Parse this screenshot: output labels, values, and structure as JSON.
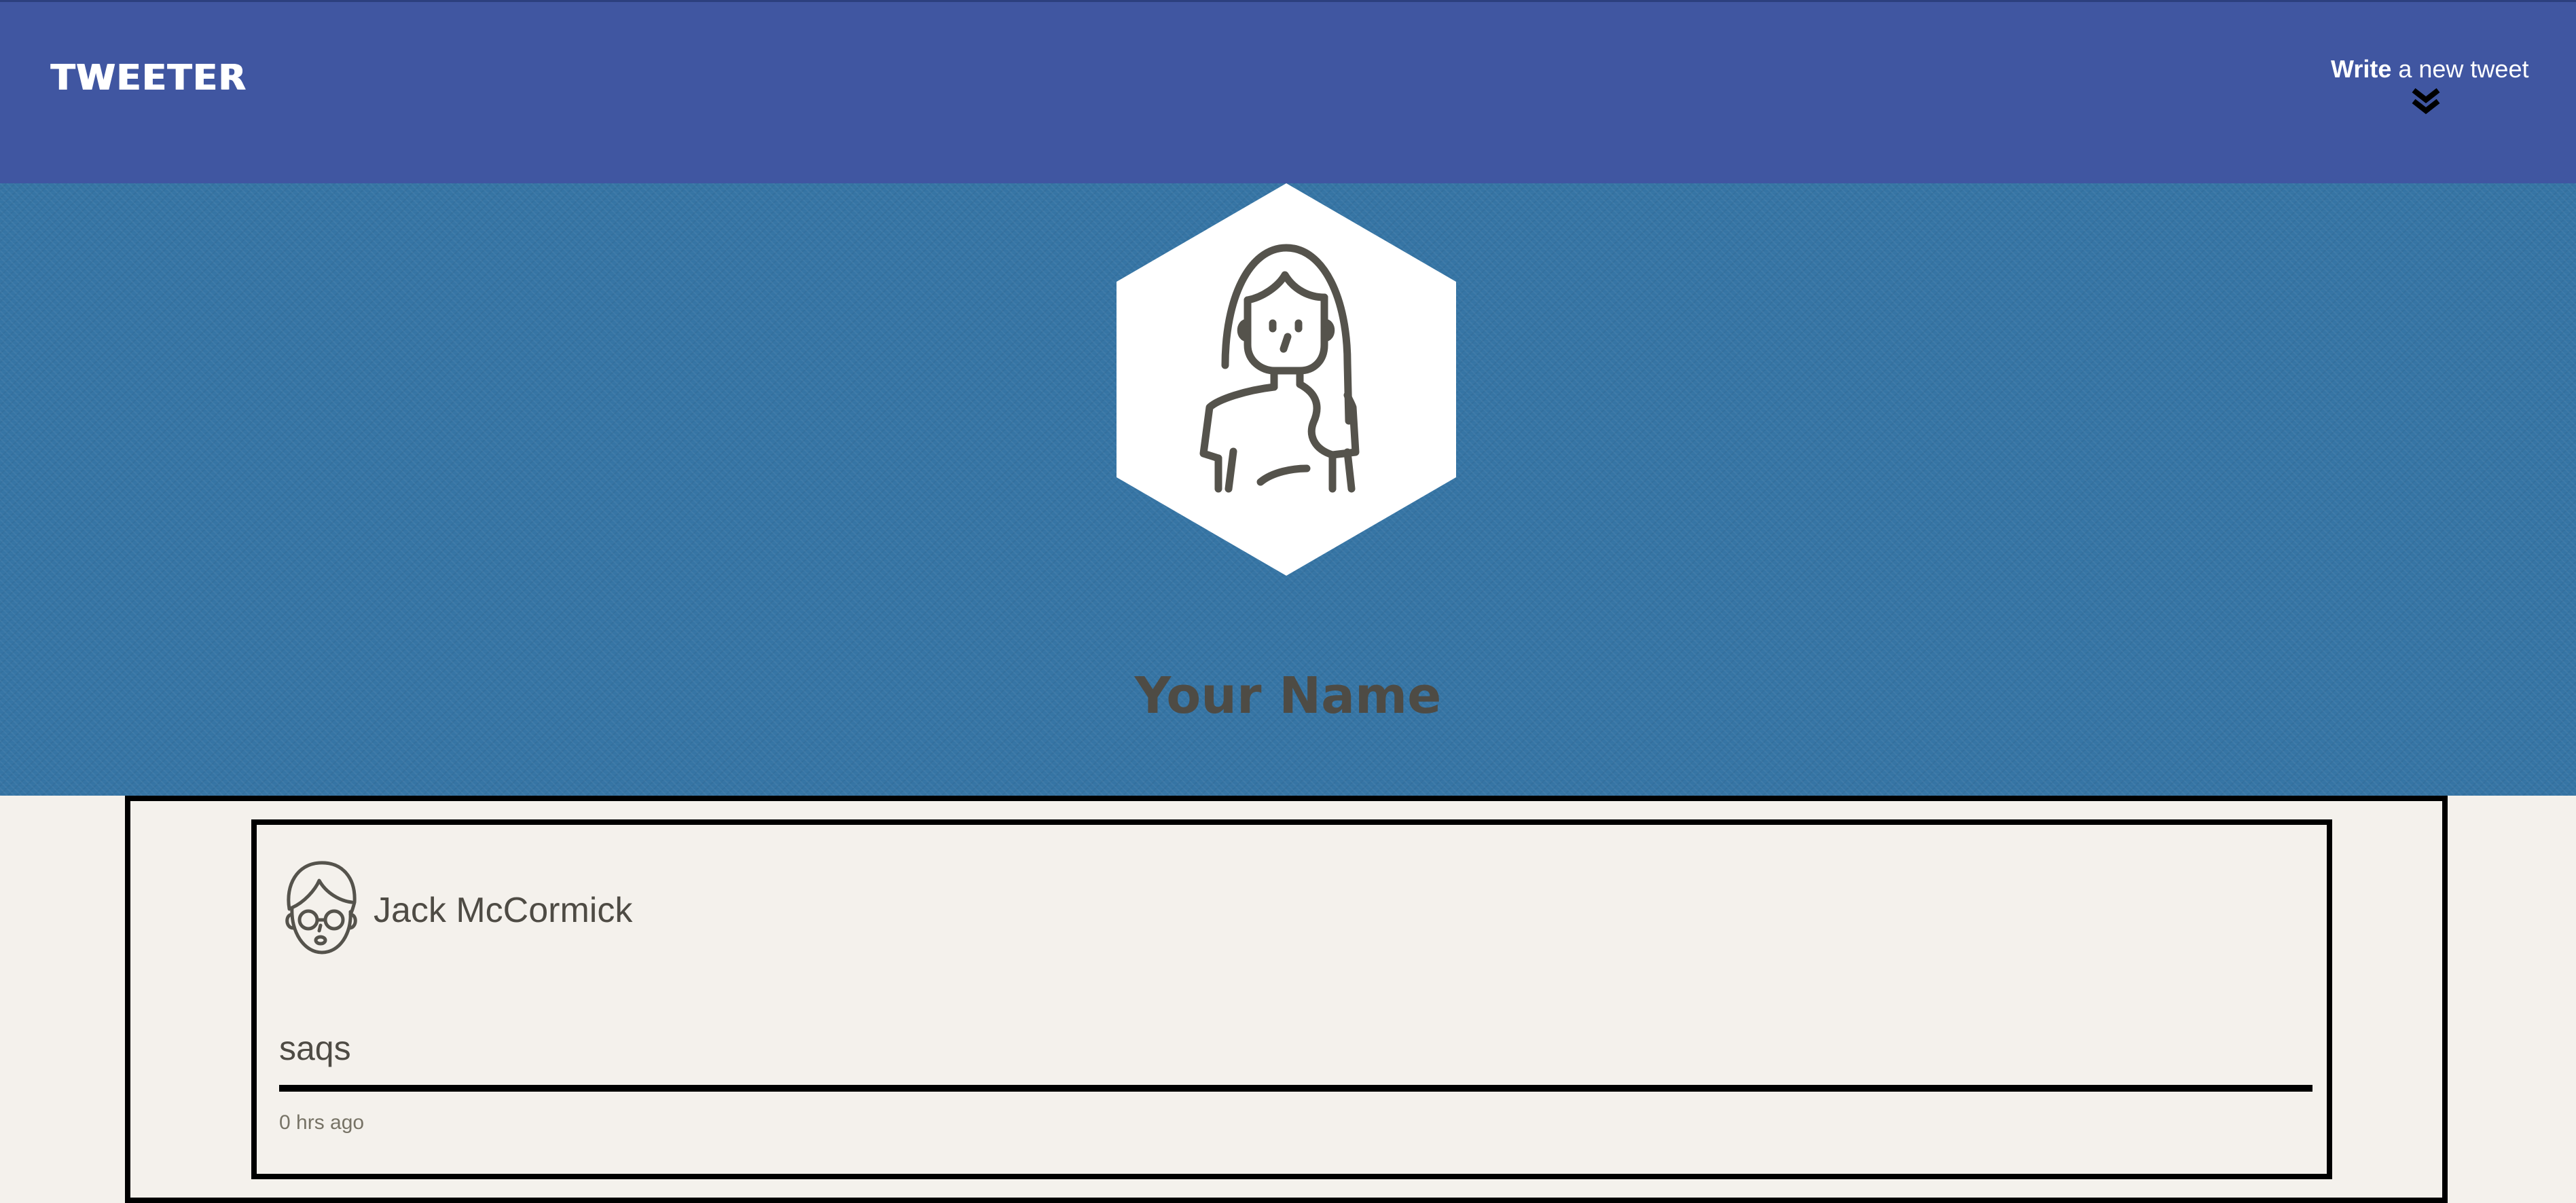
{
  "nav": {
    "brand": "TWEETER",
    "compose_bold": "Write",
    "compose_rest": " a new tweet",
    "compose_icon": "double-chevron-down-icon"
  },
  "header": {
    "avatar_icon": "woman-avatar-icon",
    "profile_name": "Your Name"
  },
  "tweets": [
    {
      "avatar_icon": "man-with-glasses-avatar-icon",
      "author": "Jack McCormick",
      "content": "saqs",
      "timestamp": "0 hrs ago"
    }
  ],
  "colors": {
    "nav_bg": "#4056a1",
    "banner_bg": "#3574a4",
    "page_bg": "#f4f1ec",
    "text": "#4e4b44"
  }
}
